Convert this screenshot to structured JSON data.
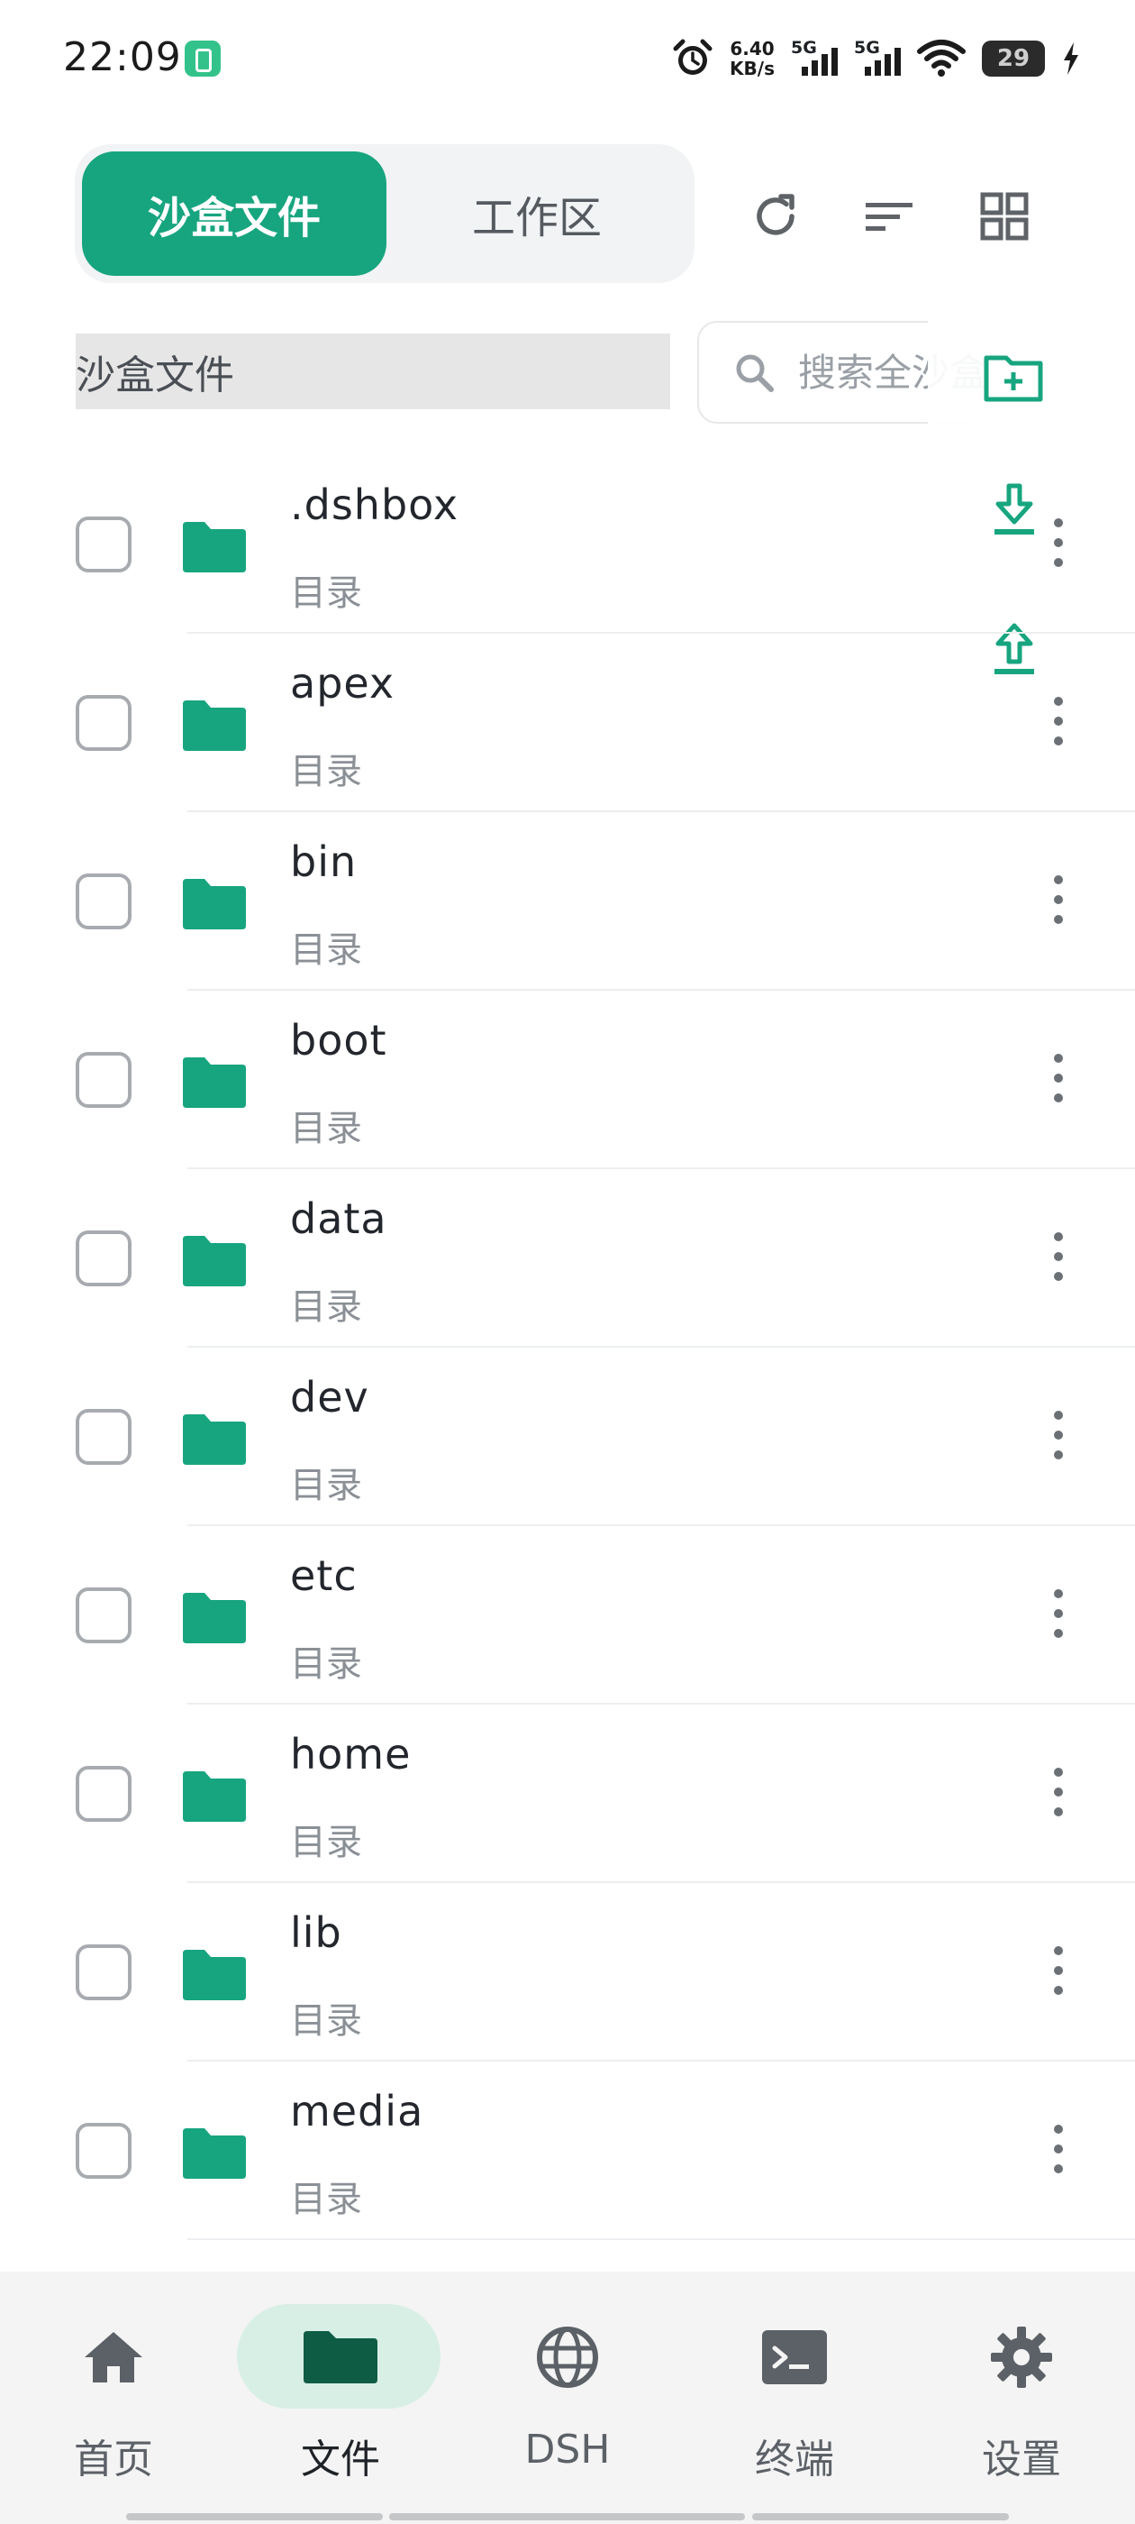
{
  "status_bar": {
    "time": "22:09",
    "net_speed_value": "6.40",
    "net_speed_unit": "KB/s",
    "signal1_label": "5G",
    "signal2_label": "5G",
    "battery_level": "29"
  },
  "header": {
    "tabs": [
      {
        "label": "沙盒文件",
        "active": true
      },
      {
        "label": "工作区",
        "active": false
      }
    ],
    "actions": [
      "refresh-icon",
      "sort-icon",
      "grid-view-icon"
    ]
  },
  "path_bar": {
    "value": "沙盒文件"
  },
  "search": {
    "placeholder": "搜索全沙盒"
  },
  "fab_actions": [
    "new-folder-icon",
    "download-icon",
    "upload-icon"
  ],
  "files": [
    {
      "name": ".dshbox",
      "type": "目录"
    },
    {
      "name": "apex",
      "type": "目录"
    },
    {
      "name": "bin",
      "type": "目录"
    },
    {
      "name": "boot",
      "type": "目录"
    },
    {
      "name": "data",
      "type": "目录"
    },
    {
      "name": "dev",
      "type": "目录"
    },
    {
      "name": "etc",
      "type": "目录"
    },
    {
      "name": "home",
      "type": "目录"
    },
    {
      "name": "lib",
      "type": "目录"
    },
    {
      "name": "media",
      "type": "目录"
    }
  ],
  "bottom_nav": [
    {
      "label": "首页",
      "icon": "home-icon",
      "active": false
    },
    {
      "label": "文件",
      "icon": "folder-icon",
      "active": true
    },
    {
      "label": "DSH",
      "icon": "globe-icon",
      "active": false
    },
    {
      "label": "终端",
      "icon": "terminal-icon",
      "active": false
    },
    {
      "label": "设置",
      "icon": "gear-icon",
      "active": false
    }
  ],
  "colors": {
    "accent": "#17a57f",
    "active_nav_pill": "#d8efe6",
    "folder": "#17a57f"
  }
}
